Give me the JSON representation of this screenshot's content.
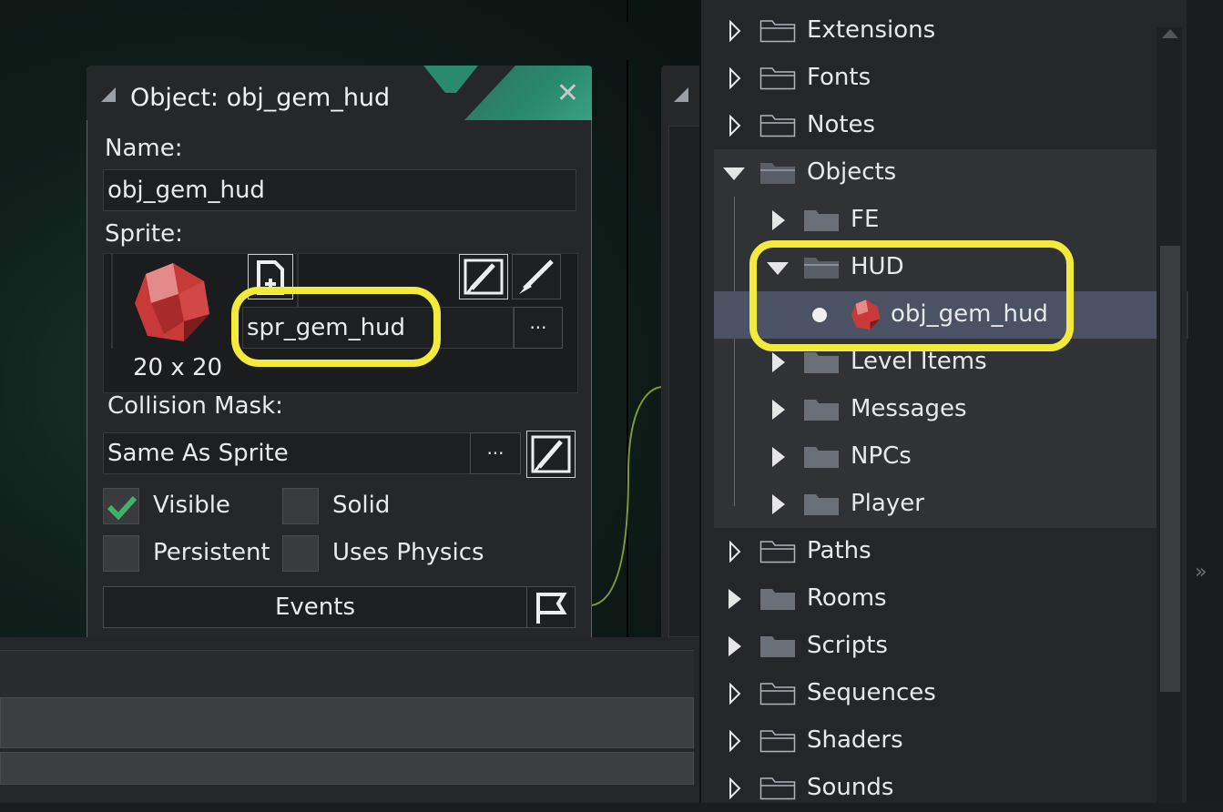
{
  "object_editor": {
    "title": "Object: obj_gem_hud",
    "name_label": "Name:",
    "name_value": "obj_gem_hud",
    "sprite_label": "Sprite:",
    "sprite_name": "spr_gem_hud",
    "sprite_size": "20 x 20",
    "browse_label": "···",
    "collision_label": "Collision Mask:",
    "collision_value": "Same As Sprite",
    "collision_browse_label": "···",
    "checkboxes": [
      {
        "label": "Visible",
        "checked": true
      },
      {
        "label": "Solid",
        "checked": false
      },
      {
        "label": "Persistent",
        "checked": false
      },
      {
        "label": "Uses Physics",
        "checked": false
      }
    ],
    "events_label": "Events"
  },
  "asset_browser": {
    "items": [
      {
        "label": "Extensions",
        "level": 0,
        "state": "closed"
      },
      {
        "label": "Fonts",
        "level": 0,
        "state": "closed"
      },
      {
        "label": "Notes",
        "level": 0,
        "state": "closed"
      },
      {
        "label": "Objects",
        "level": 0,
        "state": "open"
      },
      {
        "label": "FE",
        "level": 1,
        "state": "closed"
      },
      {
        "label": "HUD",
        "level": 1,
        "state": "open"
      },
      {
        "label": "obj_gem_hud",
        "level": 2,
        "state": "leaf",
        "selected": true
      },
      {
        "label": "Level Items",
        "level": 1,
        "state": "closed"
      },
      {
        "label": "Messages",
        "level": 1,
        "state": "closed"
      },
      {
        "label": "NPCs",
        "level": 1,
        "state": "closed"
      },
      {
        "label": "Player",
        "level": 1,
        "state": "closed"
      },
      {
        "label": "Paths",
        "level": 0,
        "state": "closed"
      },
      {
        "label": "Rooms",
        "level": 0,
        "state": "closed"
      },
      {
        "label": "Scripts",
        "level": 0,
        "state": "closed"
      },
      {
        "label": "Sequences",
        "level": 0,
        "state": "closed"
      },
      {
        "label": "Shaders",
        "level": 0,
        "state": "closed"
      },
      {
        "label": "Sounds",
        "level": 0,
        "state": "closed"
      }
    ]
  },
  "colors": {
    "highlight": "#f4ea3c",
    "accent_green": "#2a8a6c",
    "selected_row": "#4a5263",
    "check_green": "#3fb16a"
  },
  "icons": {
    "close": "close-icon",
    "grip": "window-grip-icon",
    "gem": "gem-icon",
    "edit_sprite": "edit-sprite-icon",
    "paint": "paint-brush-icon",
    "new_sprite": "new-sprite-icon",
    "events_flag": "flag-icon"
  }
}
